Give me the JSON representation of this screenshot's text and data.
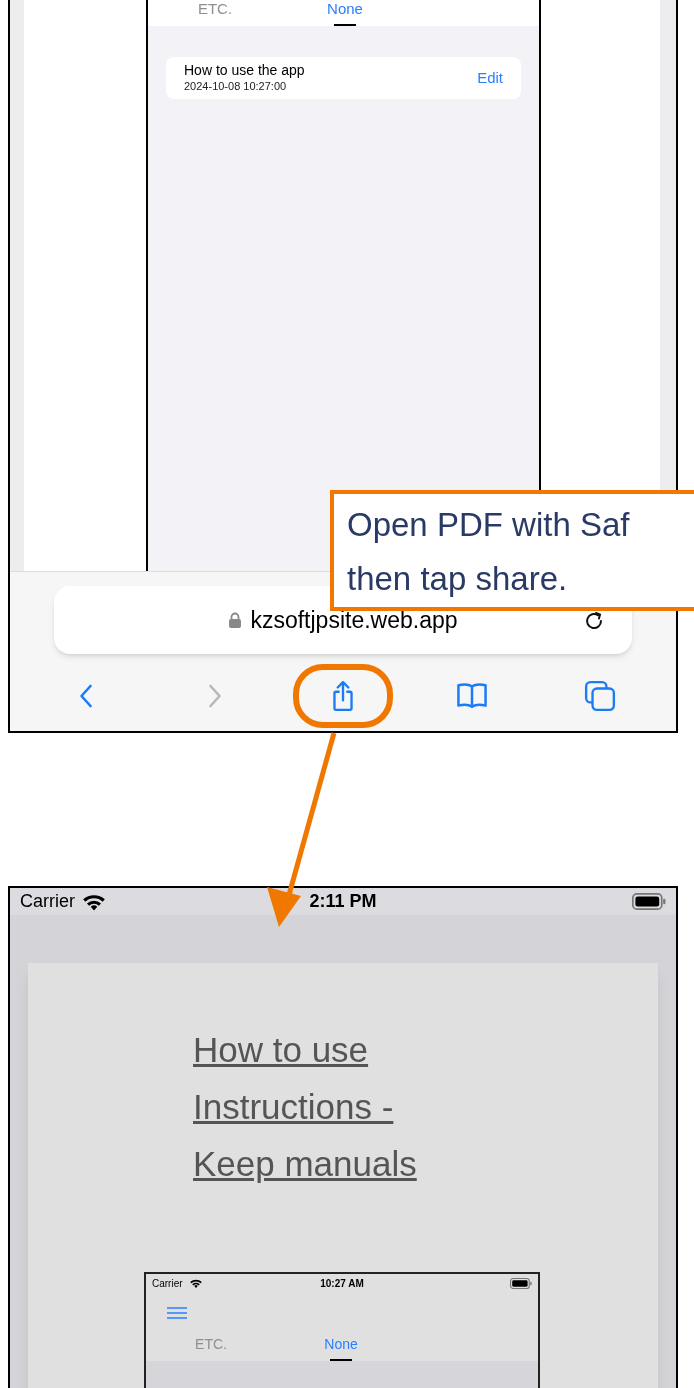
{
  "top_screenshot": {
    "tabs": [
      {
        "label": "ETC.",
        "selected": false
      },
      {
        "label": "None",
        "selected": true
      }
    ],
    "documents": [
      {
        "title": "How to use the app",
        "date": "2024-10-08 10:27:00",
        "action": "Edit"
      }
    ],
    "address_bar": {
      "url": "kzsoftjpsite.web.app"
    },
    "toolbar": [
      {
        "kind": "back",
        "disabled": false,
        "highlighted": false
      },
      {
        "kind": "forward",
        "disabled": true,
        "highlighted": false
      },
      {
        "kind": "share",
        "disabled": false,
        "highlighted": true
      },
      {
        "kind": "bookmarks",
        "disabled": false,
        "highlighted": false
      },
      {
        "kind": "tabs",
        "disabled": false,
        "highlighted": false
      }
    ]
  },
  "callout": {
    "lines": [
      "Open PDF with Saf",
      "then tap share."
    ]
  },
  "bottom_screenshot": {
    "status_bar": {
      "carrier": "Carrier",
      "time": "2:11 PM"
    },
    "pdf_title_lines": [
      "How to use",
      "Instructions -",
      "Keep manuals"
    ],
    "embedded_screenshot": {
      "status_bar": {
        "carrier": "Carrier",
        "time": "10:27 AM"
      },
      "tabs": [
        {
          "label": "ETC.",
          "selected": false
        },
        {
          "label": "None",
          "selected": true
        }
      ]
    }
  }
}
